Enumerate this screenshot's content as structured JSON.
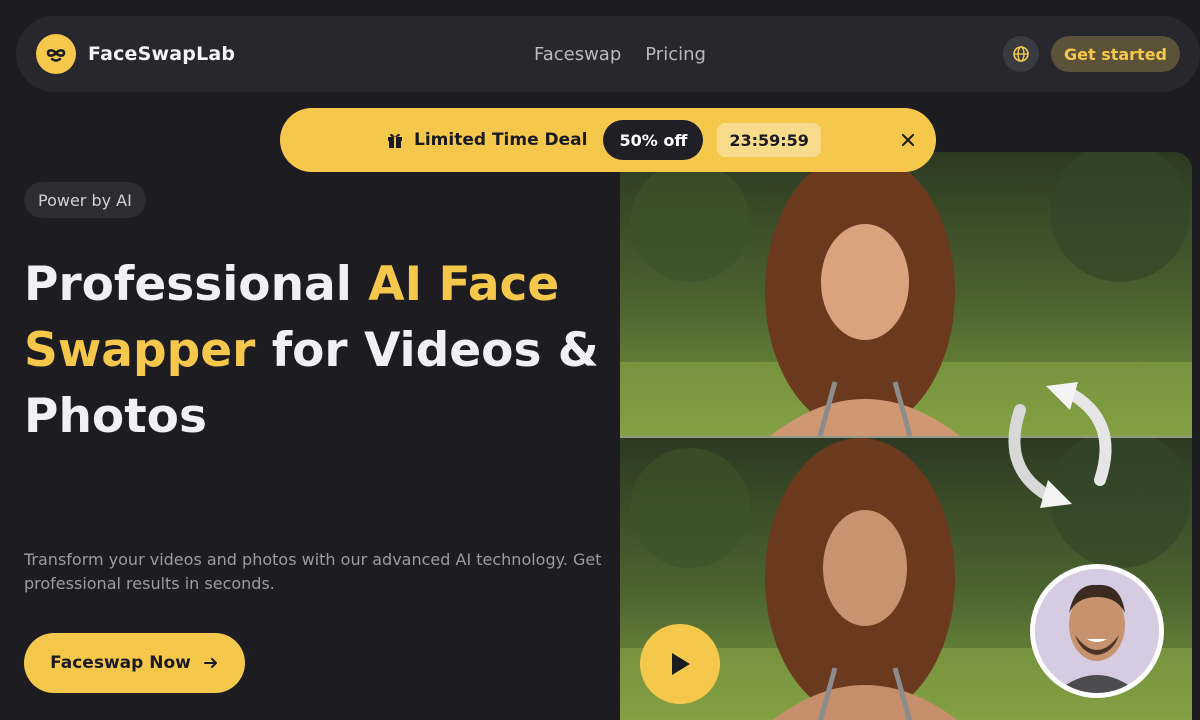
{
  "header": {
    "brand": "FaceSwapLab",
    "nav": [
      {
        "label": "Faceswap"
      },
      {
        "label": "Pricing"
      }
    ],
    "language_icon": "globe-icon",
    "cta_label": "Get started"
  },
  "deal_banner": {
    "icon": "gift-icon",
    "title": "Limited Time Deal",
    "discount": "50% off",
    "timer": "23:59:59",
    "close_icon": "close-icon"
  },
  "hero": {
    "badge": "Power by AI",
    "title_part1": "Professional ",
    "title_accent": "AI Face Swapper",
    "title_part2": " for Videos & Photos",
    "description": "Transform your videos and photos with our advanced AI technology. Get professional results in seconds.",
    "cta_label": "Faceswap Now",
    "cta_icon": "arrow-right-icon"
  },
  "media": {
    "play_icon": "play-icon",
    "swap_icon": "swap-arrows-icon"
  },
  "colors": {
    "accent": "#f5c84c",
    "background": "#1c1c21",
    "surface": "#27272d"
  }
}
